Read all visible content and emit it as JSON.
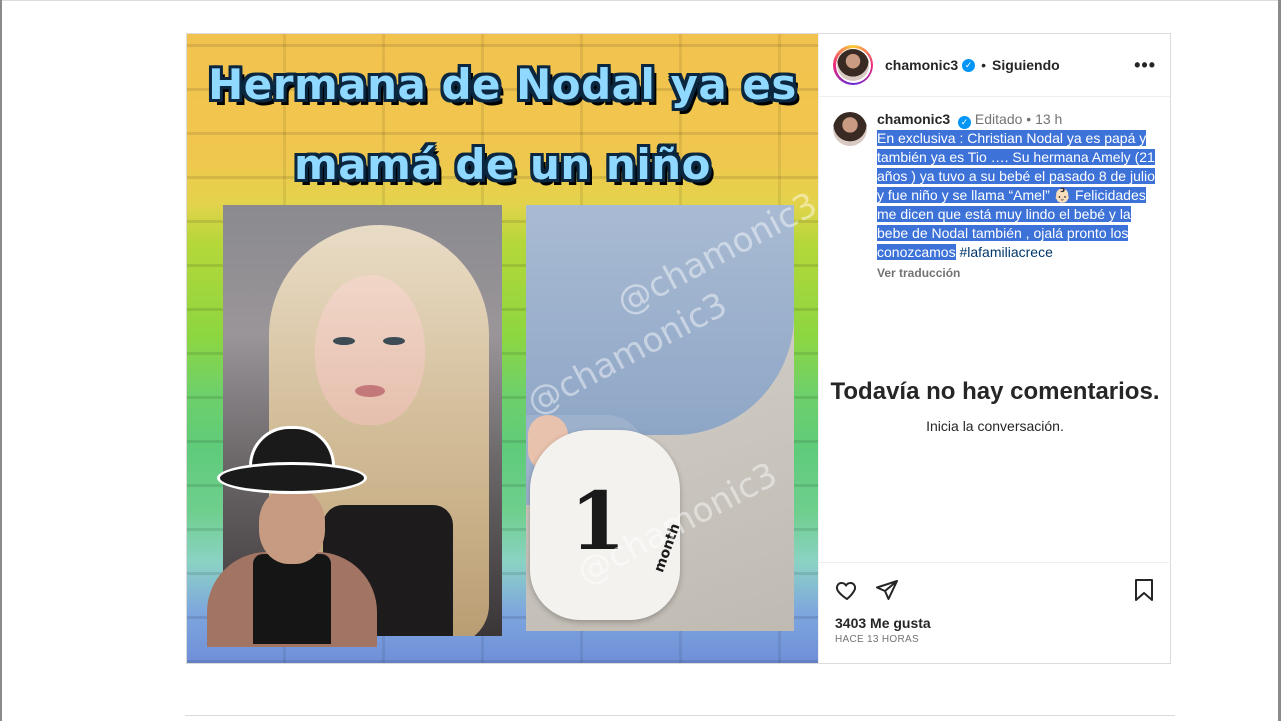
{
  "media": {
    "headline_line1": "Hermana de Nodal ya es",
    "headline_line2": "mamá de un niño",
    "card_number": "1",
    "card_unit": "month",
    "watermark": "@chamonic3"
  },
  "header": {
    "username": "chamonic3",
    "verified": "✓",
    "separator": "•",
    "follow_status": "Siguiendo",
    "more": "•••"
  },
  "caption": {
    "username": "chamonic3",
    "edited": "Editado",
    "separator": "•",
    "time": "13 h",
    "text_selected": "En exclusiva : Christian Nodal ya es papá y también ya es Tio …. Su hermana Amely (21 años ) ya tuvo a su bebé el pasado 8 de julio y fue niño y se llama “Amel” 👶🏻 Felicidades me dicen que está muy lindo el bebé y la bebe de Nodal también , ojalá pronto los conozcamos",
    "hashtag": "#lafamiliacrece",
    "see_translation": "Ver traducción"
  },
  "comments": {
    "empty_title": "Todavía no hay comentarios.",
    "empty_subtitle": "Inicia la conversación."
  },
  "actions": {
    "likes": "3403 Me gusta",
    "timestamp": "HACE 13 HORAS"
  },
  "colors": {
    "selection": "#3d72d9",
    "verified": "#0095f6",
    "hashtag": "#00376b",
    "secondary_text": "#737373"
  },
  "icons": [
    "more-icon",
    "heart-icon",
    "share-icon",
    "bookmark-icon",
    "verified-badge-icon"
  ]
}
